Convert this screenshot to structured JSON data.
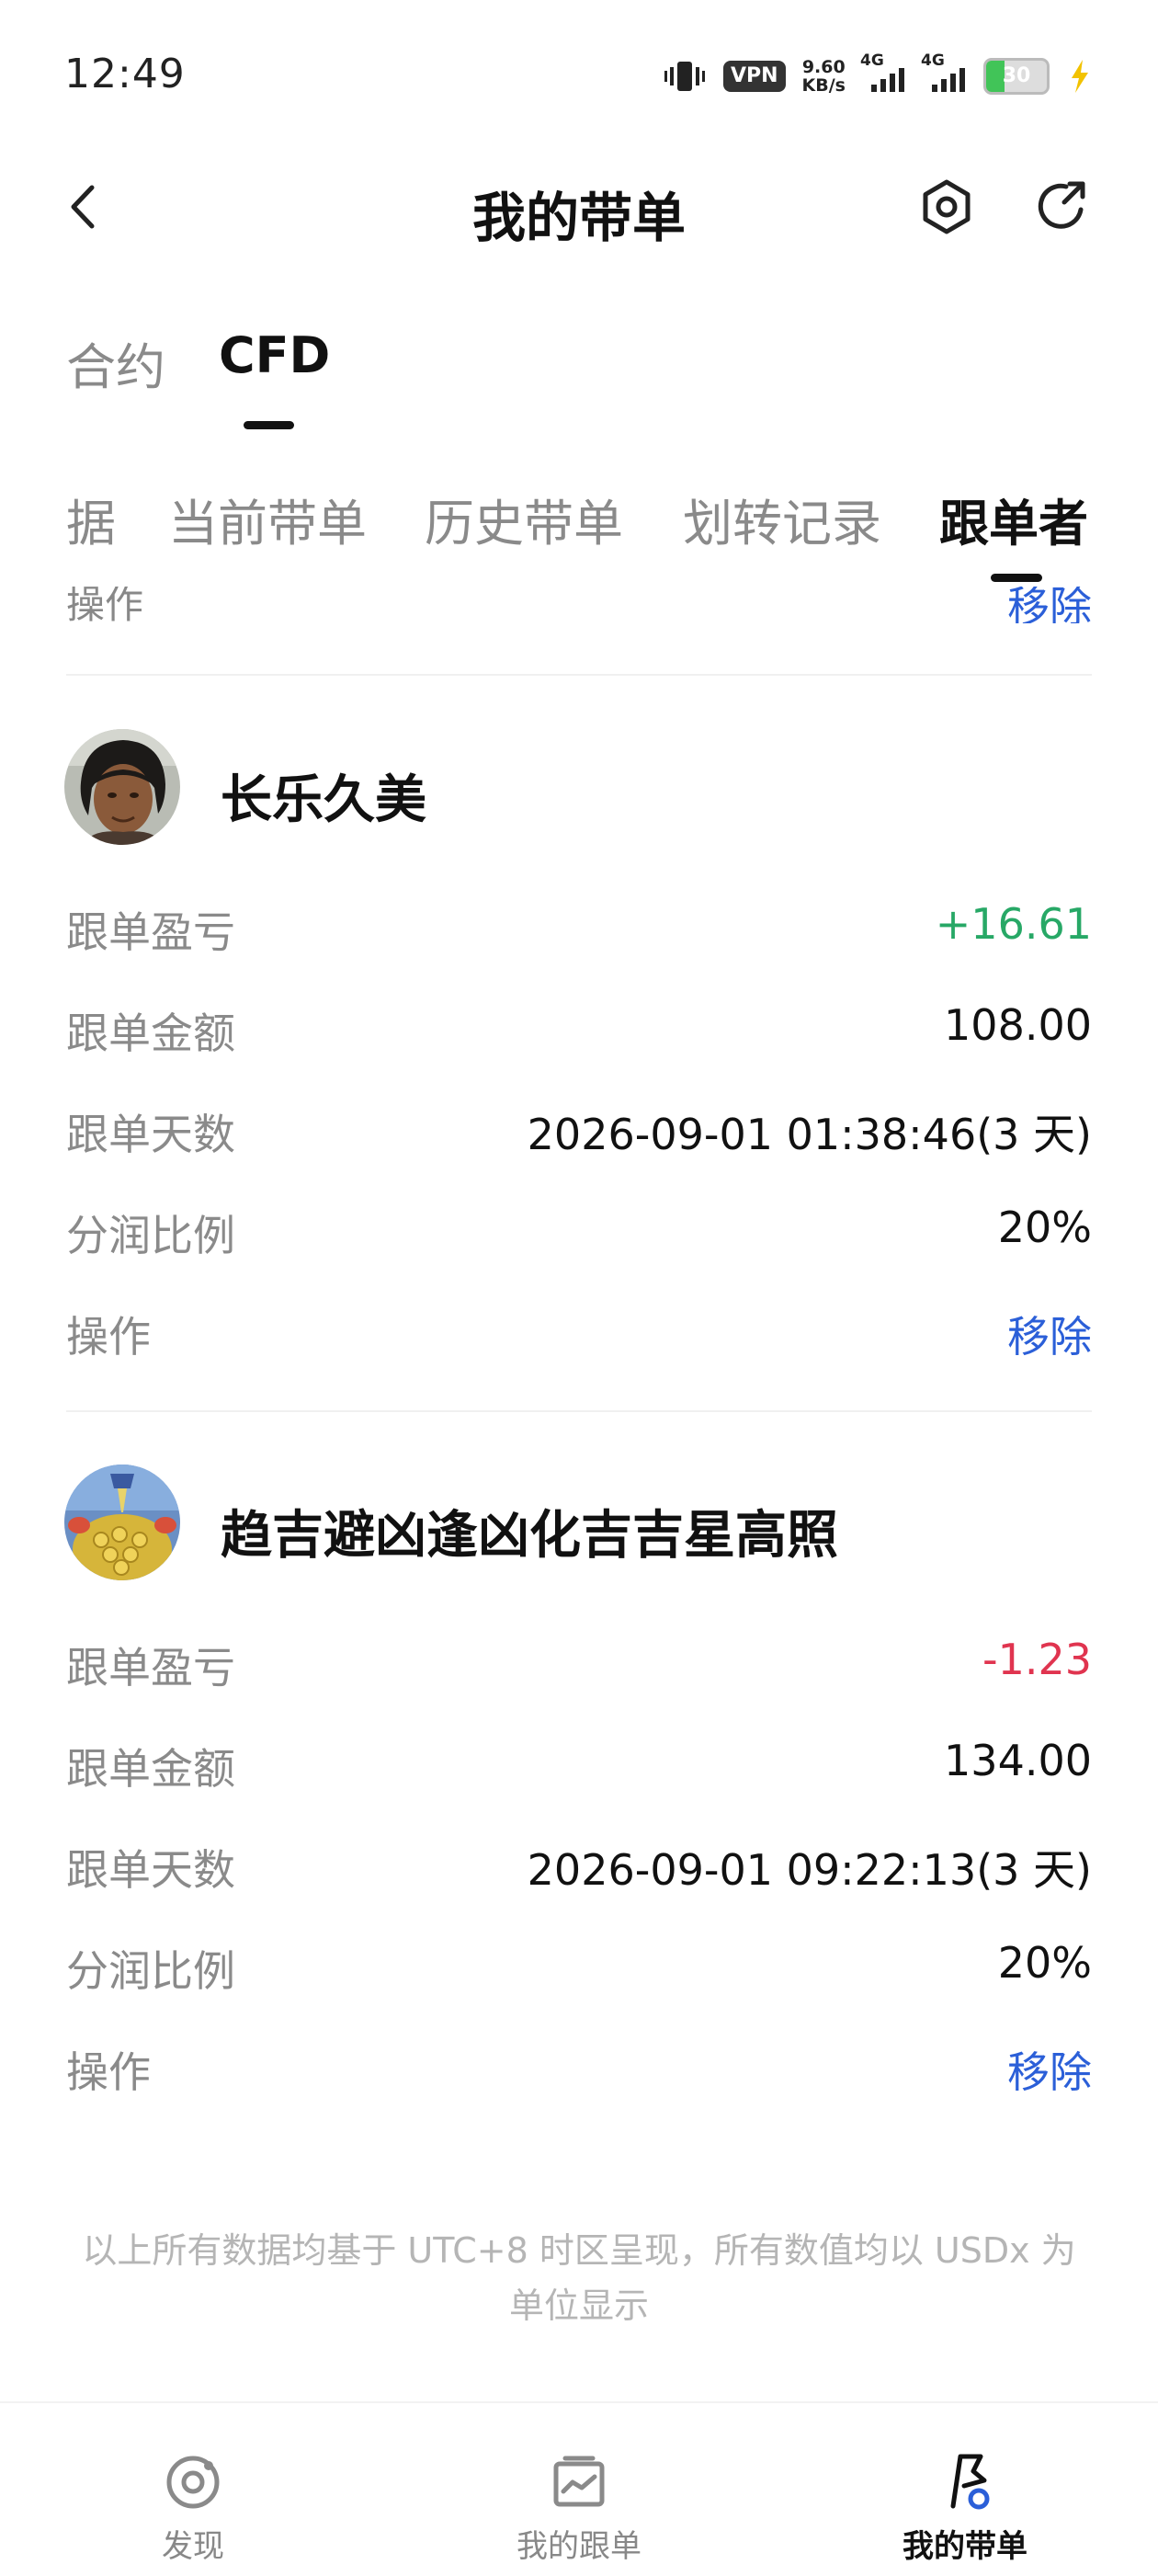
{
  "status_bar": {
    "time": "12:49",
    "vpn": "VPN",
    "speed_value": "9.60",
    "speed_unit": "KB/s",
    "network1": "4G",
    "network2": "4G",
    "battery": "30",
    "battery_level": 0.3
  },
  "header": {
    "title": "我的带单"
  },
  "product_tabs": [
    {
      "label": "合约"
    },
    {
      "label": "CFD"
    }
  ],
  "sub_tabs": [
    {
      "label": "据"
    },
    {
      "label": "当前带单"
    },
    {
      "label": "历史带单"
    },
    {
      "label": "划转记录"
    },
    {
      "label": "跟单者"
    }
  ],
  "partial_row": {
    "label": "操作",
    "action": "移除"
  },
  "followers": [
    {
      "name": "长乐久美",
      "pnl_label": "跟单盈亏",
      "pnl": "+16.61",
      "amount_label": "跟单金额",
      "amount": "108.00",
      "days_label": "跟单天数",
      "days": "2026-09-01 01:38:46(3 天)",
      "share_label": "分润比例",
      "share": "20%",
      "action_label": "操作",
      "action": "移除"
    },
    {
      "name": "趋吉避凶逢凶化吉吉星高照",
      "pnl_label": "跟单盈亏",
      "pnl": "-1.23",
      "amount_label": "跟单金额",
      "amount": "134.00",
      "days_label": "跟单天数",
      "days": "2026-09-01 09:22:13(3 天)",
      "share_label": "分润比例",
      "share": "20%",
      "action_label": "操作",
      "action": "移除"
    }
  ],
  "footnote": "以上所有数据均基于 UTC+8 时区呈现，所有数值均以 USDx 为单位显示",
  "bottom_nav": [
    {
      "label": "发现",
      "icon": "discover-icon"
    },
    {
      "label": "我的跟单",
      "icon": "chart-card-icon"
    },
    {
      "label": "我的带单",
      "icon": "flag-icon"
    }
  ],
  "colors": {
    "profit": "#27a866",
    "loss": "#e0344f",
    "action": "#2b5fd8"
  }
}
